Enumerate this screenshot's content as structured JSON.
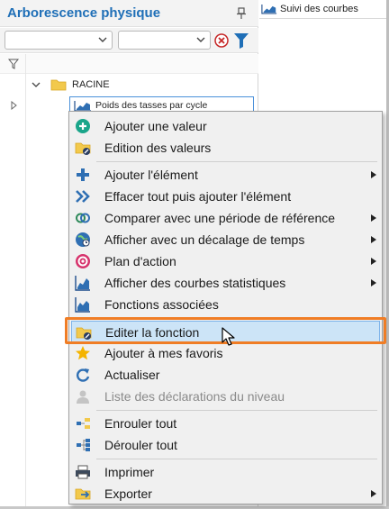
{
  "left_panel": {
    "title": "Arborescence physique",
    "filter_select_1": {
      "value": ""
    },
    "filter_select_2": {
      "value": ""
    },
    "tree": {
      "root_label": "RACINE",
      "node_label": "Poids des tasses par cycle"
    }
  },
  "right_panel": {
    "tab_label": "Suivi des courbes"
  },
  "context_menu": {
    "items": [
      {
        "label": "Ajouter une valeur",
        "icon": "add-circle-icon",
        "submenu": false,
        "disabled": false
      },
      {
        "label": "Edition des valeurs",
        "icon": "folder-edit-icon",
        "submenu": false,
        "disabled": false
      },
      {
        "label": "Ajouter l'élément",
        "icon": "plus-icon",
        "submenu": true,
        "disabled": false
      },
      {
        "label": "Effacer tout puis ajouter l'élément",
        "icon": "double-chevron-icon",
        "submenu": false,
        "disabled": false
      },
      {
        "label": "Comparer avec une période de référence",
        "icon": "compare-circles-icon",
        "submenu": true,
        "disabled": false
      },
      {
        "label": "Afficher avec un décalage de temps",
        "icon": "globe-clock-icon",
        "submenu": true,
        "disabled": false
      },
      {
        "label": "Plan d'action",
        "icon": "action-plan-icon",
        "submenu": true,
        "disabled": false
      },
      {
        "label": "Afficher des courbes statistiques",
        "icon": "stats-chart-icon",
        "submenu": true,
        "disabled": false
      },
      {
        "label": "Fonctions associées",
        "icon": "chart-functions-icon",
        "submenu": false,
        "disabled": false
      },
      {
        "label": "Editer la fonction",
        "icon": "folder-edit-icon",
        "submenu": false,
        "disabled": false,
        "highlighted": true
      },
      {
        "label": "Ajouter à mes favoris",
        "icon": "star-icon",
        "submenu": false,
        "disabled": false
      },
      {
        "label": "Actualiser",
        "icon": "refresh-icon",
        "submenu": false,
        "disabled": false
      },
      {
        "label": "Liste des déclarations du niveau",
        "icon": "person-icon",
        "submenu": false,
        "disabled": true
      },
      {
        "label": "Enrouler tout",
        "icon": "collapse-tree-icon",
        "submenu": false,
        "disabled": false
      },
      {
        "label": "Dérouler tout",
        "icon": "expand-tree-icon",
        "submenu": false,
        "disabled": false
      },
      {
        "label": "Imprimer",
        "icon": "printer-icon",
        "submenu": false,
        "disabled": false
      },
      {
        "label": "Exporter",
        "icon": "export-icon",
        "submenu": true,
        "disabled": false
      }
    ]
  },
  "colors": {
    "title_blue": "#1f6fb7",
    "highlight_fill": "#cce4f7",
    "highlight_frame": "#f07d25",
    "menu_bg": "#f0f0f0"
  }
}
